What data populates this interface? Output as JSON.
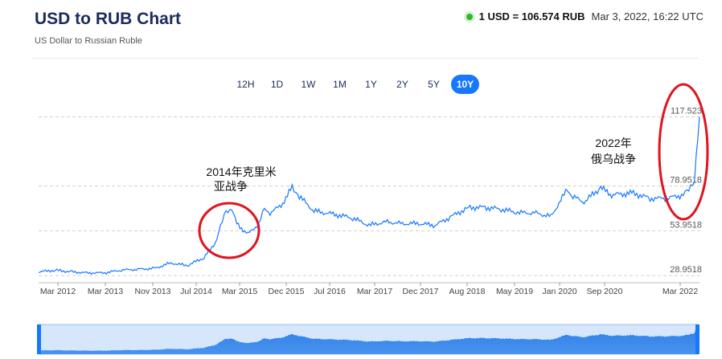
{
  "header": {
    "title": "USD to RUB Chart",
    "subtitle": "US Dollar to Russian Ruble",
    "rate": "1 USD = 106.574 RUB",
    "timestamp": "Mar 3, 2022, 16:22 UTC"
  },
  "ranges": {
    "items": [
      "12H",
      "1D",
      "1W",
      "1M",
      "1Y",
      "2Y",
      "5Y",
      "10Y"
    ],
    "active": "10Y"
  },
  "annotations": {
    "crimea_line1": "2014年克里米",
    "crimea_line2": "亚战争",
    "war_line1": "2022年",
    "war_line2": "俄乌战争"
  },
  "colors": {
    "line": "#1677ff",
    "accent": "#1677ff",
    "highlight_circle": "#e0141e",
    "live": "#2eb82e"
  },
  "chart_data": {
    "type": "line",
    "series": [
      {
        "name": "USD/RUB",
        "x": [
          "2012-03",
          "2012-06",
          "2012-09",
          "2012-12",
          "2013-03",
          "2013-06",
          "2013-09",
          "2013-12",
          "2014-03",
          "2014-06",
          "2014-09",
          "2014-11",
          "2014-12",
          "2015-01",
          "2015-02",
          "2015-03",
          "2015-05",
          "2015-07",
          "2015-08",
          "2015-09",
          "2015-11",
          "2016-01",
          "2016-02",
          "2016-05",
          "2016-09",
          "2016-12",
          "2017-03",
          "2017-06",
          "2017-09",
          "2017-12",
          "2018-03",
          "2018-06",
          "2018-09",
          "2018-12",
          "2019-03",
          "2019-06",
          "2019-09",
          "2019-12",
          "2020-03",
          "2020-04",
          "2020-06",
          "2020-09",
          "2020-11",
          "2021-03",
          "2021-06",
          "2021-09",
          "2021-12",
          "2022-01",
          "2022-02",
          "2022-03"
        ],
        "y": [
          31,
          32,
          31,
          30.5,
          30.5,
          32,
          32.5,
          33,
          36,
          34.5,
          39,
          47,
          56,
          65,
          66,
          58,
          52,
          58,
          66,
          64,
          68,
          78,
          74,
          65,
          63,
          61,
          57,
          59,
          58,
          58,
          57,
          62,
          67,
          67,
          66,
          64,
          64,
          62,
          77,
          73,
          70,
          78,
          74,
          75,
          72,
          72,
          74,
          77,
          83,
          117.5
        ]
      }
    ],
    "ylim": [
      25,
      120
    ],
    "yticks": [
      "117.523",
      "78.9518",
      "53.9518",
      "28.9518"
    ],
    "xticks": [
      "Mar 2012",
      "Mar 2013",
      "Nov 2013",
      "Jul 2014",
      "Mar 2015",
      "Dec 2015",
      "Jul 2016",
      "Mar 2017",
      "Dec 2017",
      "Aug 2018",
      "May 2019",
      "Jan 2020",
      "Sep 2020",
      "Mar 2022"
    ],
    "grid": true
  }
}
